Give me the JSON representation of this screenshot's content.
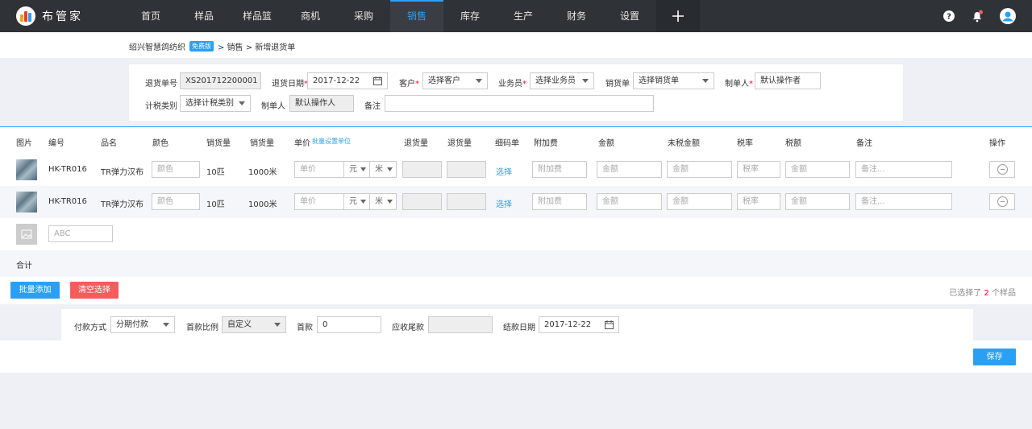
{
  "app": {
    "name": "布管家"
  },
  "nav": [
    "首页",
    "样品",
    "样品篮",
    "商机",
    "采购",
    "销售",
    "库存",
    "生产",
    "财务",
    "设置"
  ],
  "breadcrumb": {
    "company": "绍兴智慧鸽纺织",
    "badge": "免费版",
    "path": "> 销售 > 新增退货单"
  },
  "form": {
    "return_no_label": "退货单号",
    "return_no": "XS201712200001",
    "return_date_label": "退货日期",
    "return_date": "2017-12-22",
    "customer_label": "客户",
    "customer_value": "选择客户",
    "salesperson_label": "业务员",
    "salesperson_value": "选择业务员",
    "sales_order_label": "销货单",
    "sales_order_value": "选择销货单",
    "maker_label": "制单人",
    "maker_value": "默认操作者",
    "tax_label": "计税类别",
    "tax_value": "选择计税类别",
    "maker2_label": "制单人",
    "maker2_value": "默认操作人",
    "note_label": "备注"
  },
  "table": {
    "headers": [
      "图片",
      "编号",
      "品名",
      "颜色",
      "销货量",
      "销货量",
      "单价",
      "退货量",
      "退货量",
      "细码单",
      "附加费",
      "金额",
      "未税金额",
      "税率",
      "税额",
      "备注",
      "操作"
    ],
    "batch_unit": "批量设置单位",
    "rows": [
      {
        "code": "HK-TR016",
        "name": "TR弹力汉布",
        "color_ph": "颜色",
        "qty1": "10匹",
        "qty2": "1000米",
        "price_ph": "单价",
        "unit1": "元",
        "unit2": "米",
        "select": "选择",
        "fee_ph": "附加费",
        "amount_ph": "金额",
        "net_ph": "金额",
        "rate_ph": "税率",
        "tax_ph": "金额",
        "note_ph": "备注..."
      },
      {
        "code": "HK-TR016",
        "name": "TR弹力汉布",
        "color_ph": "颜色",
        "qty1": "10匹",
        "qty2": "1000米",
        "price_ph": "单价",
        "unit1": "元",
        "unit2": "米",
        "select": "选择",
        "fee_ph": "附加费",
        "amount_ph": "金额",
        "net_ph": "金额",
        "rate_ph": "税率",
        "tax_ph": "金额",
        "note_ph": "备注..."
      }
    ],
    "new_row_ph": "ABC",
    "total_label": "合计"
  },
  "actions": {
    "batch_add": "批量添加",
    "clear": "清空选择",
    "selected_prefix": "已选择了",
    "selected_count": "2",
    "selected_suffix": "个样品"
  },
  "payment": {
    "method_label": "付款方式",
    "method_value": "分期付款",
    "ratio_label": "首款比例",
    "ratio_value": "自定义",
    "first_label": "首款",
    "first_value": "0",
    "tail_label": "应收尾款",
    "settle_label": "结款日期",
    "settle_value": "2017-12-22"
  },
  "save_label": "保存",
  "colors": {
    "accent": "#2aa0f5",
    "danger": "#f55c5c",
    "topbar": "#2f3236"
  }
}
